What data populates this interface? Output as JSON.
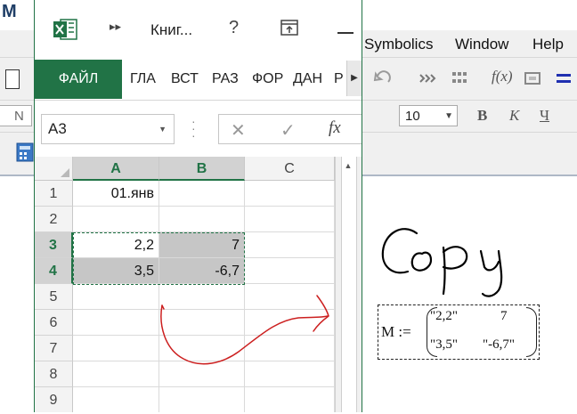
{
  "background_app": {
    "logo_letter": "M",
    "menu": [
      "Symbolics",
      "Window",
      "Help"
    ],
    "font_size": "10",
    "format_buttons": [
      "B",
      "K",
      "Ч"
    ]
  },
  "excel": {
    "title": "Книг...",
    "help": "?",
    "tabs": {
      "file": "ФАЙЛ",
      "items": [
        "ГЛА",
        "ВСТ",
        "РАЗ",
        "ФОР",
        "ДАН",
        "Р"
      ]
    },
    "name_box": "A3",
    "fx_label": "fx",
    "columns": [
      "A",
      "B",
      "C"
    ],
    "rows": [
      "1",
      "2",
      "3",
      "4",
      "5",
      "6",
      "7",
      "8",
      "9"
    ],
    "cells": {
      "A1": "01.янв",
      "A3": "2,2",
      "B3": "7",
      "A4": "3,5",
      "B4": "-6,7"
    }
  },
  "math_region": {
    "variable": "M :=",
    "matrix": [
      "\"2,2\"",
      "7",
      "\"3,5\"",
      "\"-6,7\""
    ]
  },
  "annotation": {
    "handwritten_text": "Copy",
    "arrow_color": "#cc1f1f"
  },
  "colors": {
    "excel_green": "#217346",
    "selection_gray": "#c6c6c6"
  }
}
